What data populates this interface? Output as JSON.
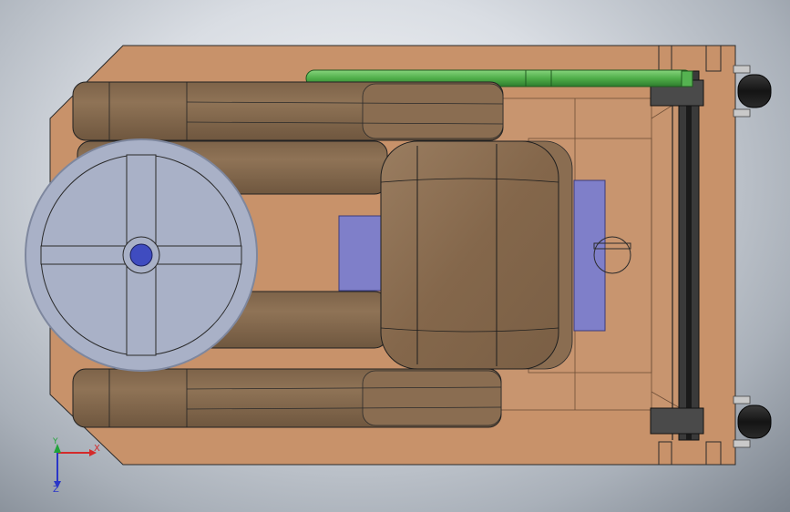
{
  "view": {
    "background_center": "#f6f7f9",
    "background_edge": "#7b838d"
  },
  "model": {
    "parts": [
      {
        "name": "base-plate",
        "color": "#c8926a"
      },
      {
        "name": "seat-cushion",
        "color": "#8d7155"
      },
      {
        "name": "armrest-cushion",
        "color": "#8d7155"
      },
      {
        "name": "steering-wheel",
        "color": "#a9b1c7"
      },
      {
        "name": "steering-hub",
        "color": "#3f4cc0"
      },
      {
        "name": "motor-housing",
        "color": "#d4785c"
      },
      {
        "name": "battery-block",
        "color": "#7f7fc9"
      },
      {
        "name": "handle-bar",
        "color": "#55b251"
      },
      {
        "name": "rear-axle",
        "color": "#2b2b2b"
      },
      {
        "name": "wheel",
        "color": "#1d1d1d"
      }
    ]
  },
  "triad": {
    "x_label": "X",
    "y_label": "Y",
    "z_label": "Z",
    "x_color": "#d42a2a",
    "y_color": "#22a33a",
    "z_color": "#2a36c8"
  }
}
